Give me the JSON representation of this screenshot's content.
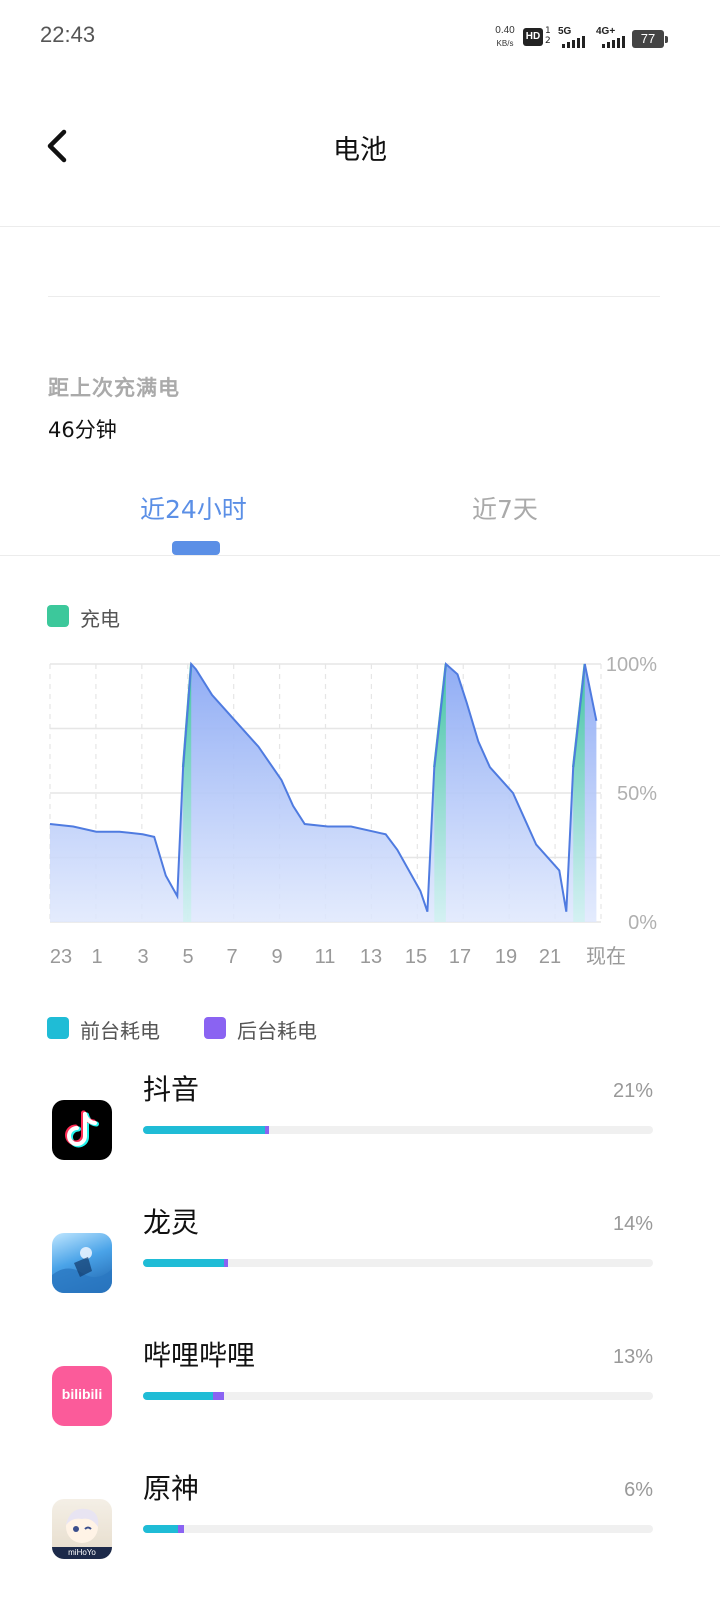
{
  "status_bar": {
    "time": "22:43",
    "net_speed_value": "0.40",
    "net_speed_unit": "KB/s",
    "hd_label": "HD",
    "hd_sub_top": "1",
    "hd_sub_bottom": "2",
    "sim1_label": "5G",
    "sim2_label": "4G+",
    "battery_level": "77"
  },
  "header": {
    "title": "电池",
    "back_icon": "chevron-left-icon"
  },
  "summary": {
    "since_full_label": "距上次充满电",
    "since_full_value": "46分钟"
  },
  "tabs": [
    {
      "label": "近24小时",
      "active": true
    },
    {
      "label": "近7天",
      "active": false
    }
  ],
  "chart_legend": {
    "charging_label": "充电",
    "charging_color": "#3cc89b"
  },
  "chart_data": {
    "type": "area",
    "ylabels": [
      "100%",
      "50%",
      "0%"
    ],
    "xlabels": [
      "23",
      "1",
      "3",
      "5",
      "7",
      "9",
      "11",
      "13",
      "15",
      "17",
      "19",
      "21",
      "现在"
    ],
    "series": [
      {
        "x": [
          0,
          1,
          2,
          3,
          4,
          4.5,
          5,
          5.5,
          5.75,
          6.1,
          6.3,
          7,
          8,
          9,
          10,
          10.5,
          11,
          12,
          13,
          14,
          14.5,
          15,
          16,
          16.3,
          16.6,
          17.1,
          17.6,
          18,
          18.5,
          19,
          20,
          20.5,
          21,
          22,
          22.3,
          22.6,
          23.1,
          23.6
        ],
        "y": [
          38,
          37,
          35,
          35,
          34,
          33,
          18,
          10,
          60,
          100,
          98,
          88,
          78,
          68,
          55,
          45,
          38,
          37,
          37,
          35,
          34,
          28,
          12,
          4,
          60,
          100,
          96,
          85,
          70,
          60,
          50,
          40,
          30,
          20,
          4,
          60,
          100,
          78
        ],
        "charging_segments": [
          [
            5.75,
            6.1
          ],
          [
            16.6,
            17.1
          ],
          [
            22.6,
            23.1
          ]
        ]
      }
    ],
    "ylim": [
      0,
      100
    ],
    "grid": true,
    "fill_color": "#9db6f5",
    "line_color": "#4f7be0",
    "charging_color": "#3cc89b"
  },
  "usage_legend": {
    "foreground_label": "前台耗电",
    "foreground_color": "#1fbcd6",
    "background_label": "后台耗电",
    "background_color": "#8a63f2"
  },
  "apps": [
    {
      "name": "抖音",
      "percent_label": "21%",
      "foreground_pct": 21,
      "background_pct": 0.8,
      "icon": "douyin-icon"
    },
    {
      "name": "龙灵",
      "percent_label": "14%",
      "foreground_pct": 14,
      "background_pct": 0.7,
      "icon": "game-icon"
    },
    {
      "name": "哔哩哔哩",
      "percent_label": "13%",
      "foreground_pct": 12,
      "background_pct": 2,
      "icon": "bilibili-icon",
      "icon_text": "bilibili"
    },
    {
      "name": "原神",
      "percent_label": "6%",
      "foreground_pct": 6,
      "background_pct": 1,
      "icon": "genshin-icon",
      "icon_text": "miHoYo"
    }
  ]
}
